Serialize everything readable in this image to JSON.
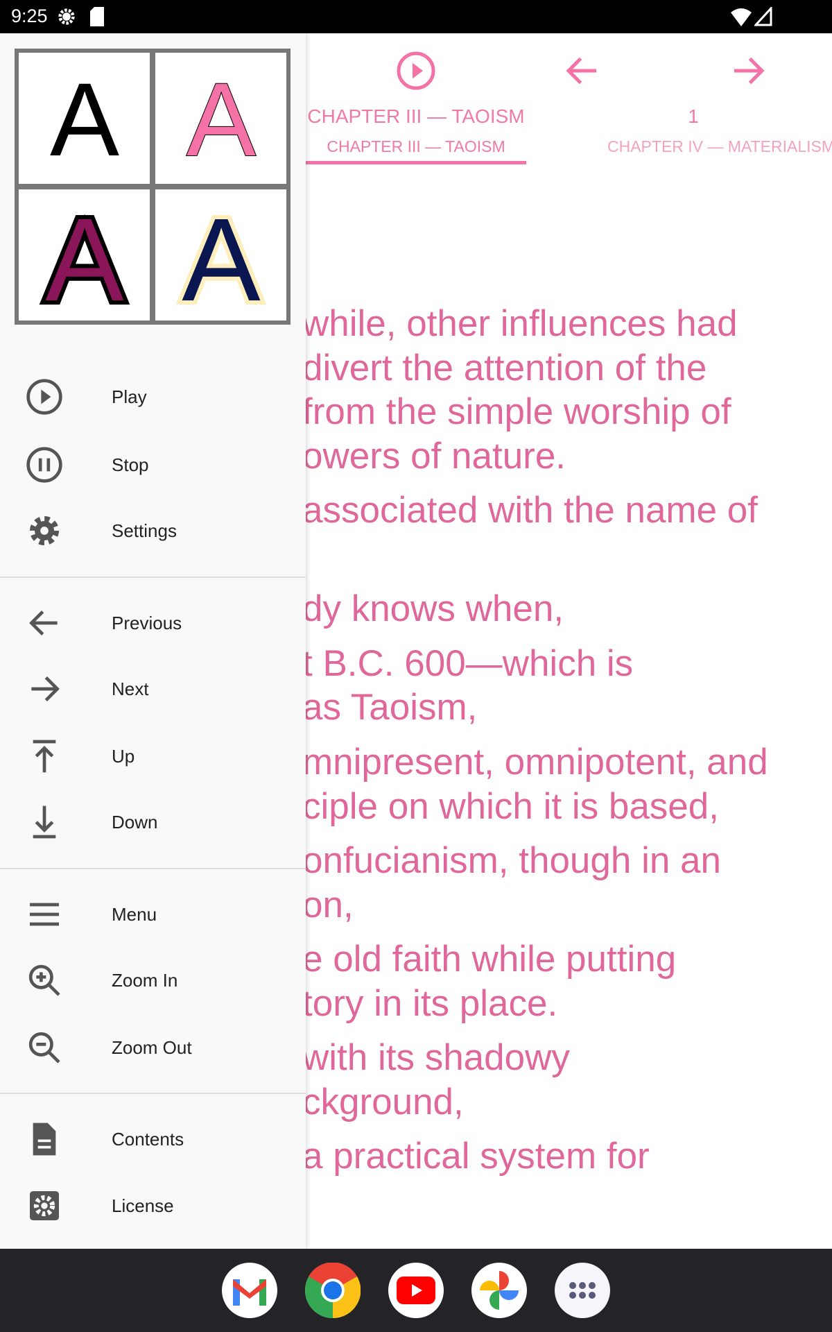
{
  "status": {
    "time": "9:25"
  },
  "header": {
    "current_title": "CHAPTER III — TAOISM",
    "current_sub": "CHAPTER III — TAOISM",
    "next_title": "1",
    "next_sub": "CHAPTER IV — MATERIALISM",
    "accent": "#f472a6"
  },
  "text_lines": [
    "while, other influences had",
    "divert the attention of the",
    "from the simple worship of",
    "owers of nature.",
    "associated with the name of",
    "dy knows when,",
    "t B.C. 600—which is",
    "as Taoism,",
    "mnipresent, omnipotent, and",
    "ciple on which it is based,",
    "onfucianism, though in an",
    "on,",
    "e old faith while putting",
    "tory in its place.",
    "with its shadowy",
    "ckground,",
    "a practical system for"
  ],
  "drawer": {
    "font_styles": [
      {
        "letter": "A",
        "fg": "#000000",
        "outline": "none"
      },
      {
        "letter": "A",
        "fg": "#f472a6",
        "outline": "#000000"
      },
      {
        "letter": "A",
        "fg": "#8a1558",
        "outline": "#000000"
      },
      {
        "letter": "A",
        "fg": "#0a1650",
        "outline": "#fdeebb"
      }
    ],
    "items": [
      {
        "label": "Play",
        "icon": "play-circle-icon"
      },
      {
        "label": "Stop",
        "icon": "pause-circle-icon"
      },
      {
        "label": "Settings",
        "icon": "gear-icon"
      },
      {
        "label": "Previous",
        "icon": "arrow-left-icon"
      },
      {
        "label": "Next",
        "icon": "arrow-right-icon"
      },
      {
        "label": "Up",
        "icon": "arrow-up-to-top-icon"
      },
      {
        "label": "Down",
        "icon": "arrow-down-to-bottom-icon"
      },
      {
        "label": "Menu",
        "icon": "menu-icon"
      },
      {
        "label": "Zoom In",
        "icon": "zoom-in-icon"
      },
      {
        "label": "Zoom Out",
        "icon": "zoom-out-icon"
      },
      {
        "label": "Contents",
        "icon": "document-icon"
      },
      {
        "label": "License",
        "icon": "gear-box-icon"
      }
    ]
  },
  "dock": [
    "gmail",
    "chrome",
    "youtube",
    "photos",
    "app-drawer"
  ]
}
